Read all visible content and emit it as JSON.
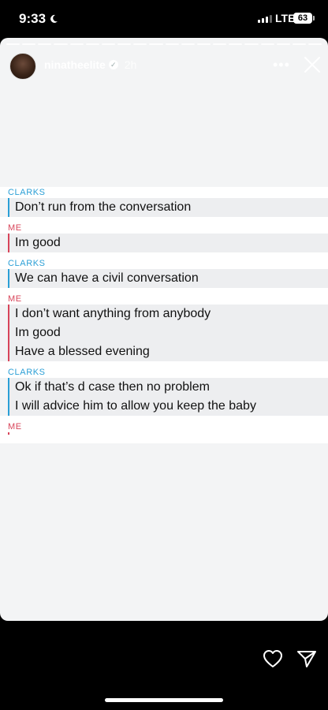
{
  "status_bar": {
    "time": "9:33",
    "network": "LTE",
    "battery": "63"
  },
  "story": {
    "username": "ninatheelite",
    "age": "2h",
    "more_icon": "ellipsis-icon",
    "close_icon": "close-icon"
  },
  "chat": {
    "groups": [
      {
        "sender": "CLARKS",
        "lines": [
          "Don’t run from the conversation"
        ]
      },
      {
        "sender": "ME",
        "lines": [
          "Im good"
        ]
      },
      {
        "sender": "CLARKS",
        "lines": [
          "We can have a civil conversation"
        ]
      },
      {
        "sender": "ME",
        "lines": [
          "I don’t want anything from anybody",
          "Im good",
          "Have a blessed evening"
        ]
      },
      {
        "sender": "CLARKS",
        "lines": [
          "Ok if that’s d case then no problem",
          "I will advice him to allow you keep the baby"
        ]
      },
      {
        "sender": "ME",
        "lines": []
      }
    ]
  },
  "colors": {
    "clarks": "#2b9fd6",
    "me": "#d8455a",
    "story_bg": "#f3f4f5"
  }
}
